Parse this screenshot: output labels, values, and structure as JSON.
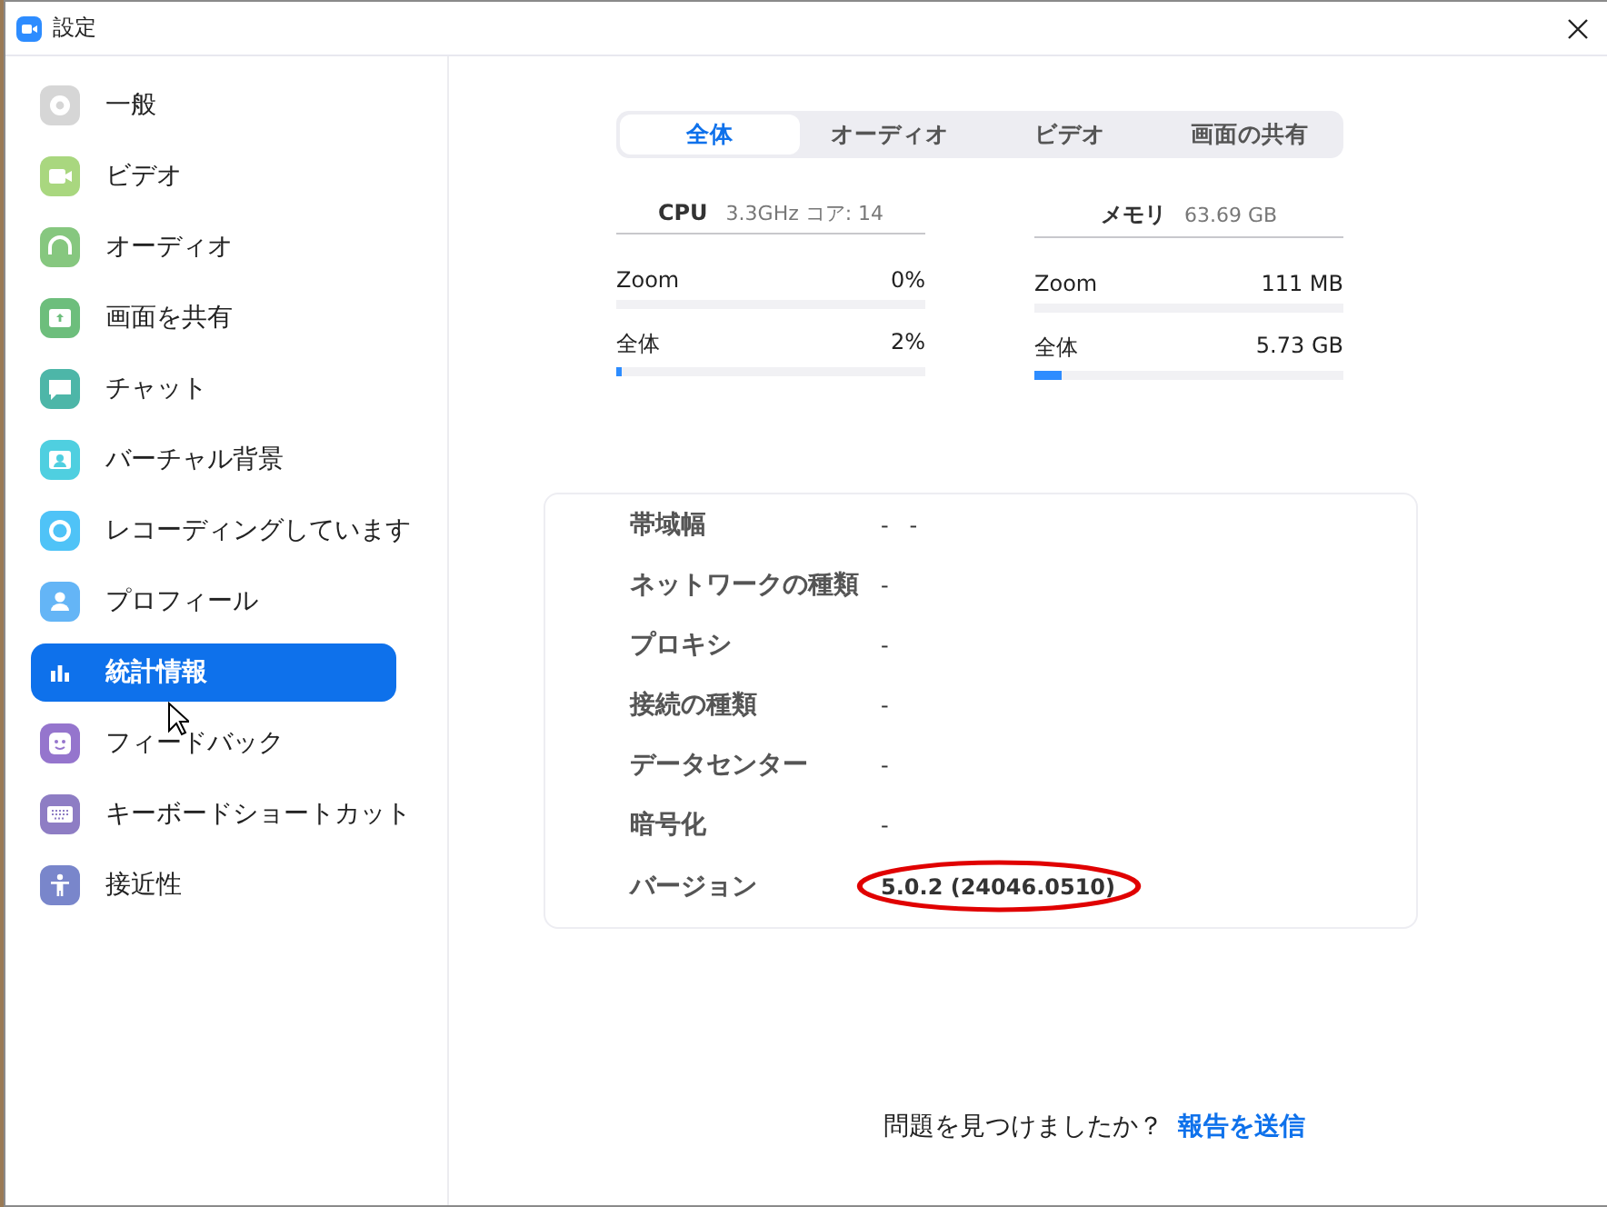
{
  "window": {
    "title": "設定"
  },
  "sidebar": {
    "items": [
      {
        "label": "一般",
        "kind": "gear",
        "color": "#d6d6d6",
        "selected": false
      },
      {
        "label": "ビデオ",
        "kind": "camera",
        "color": "#a9d77f",
        "selected": false
      },
      {
        "label": "オーディオ",
        "kind": "headphones",
        "color": "#86c77f",
        "selected": false
      },
      {
        "label": "画面を共有",
        "kind": "share",
        "color": "#6dbe7c",
        "selected": false
      },
      {
        "label": "チャット",
        "kind": "chat",
        "color": "#4db6a8",
        "selected": false
      },
      {
        "label": "バーチャル背景",
        "kind": "person-card",
        "color": "#4fcfe0",
        "selected": false
      },
      {
        "label": "レコーディングしています",
        "kind": "record",
        "color": "#4fc3f7",
        "selected": false
      },
      {
        "label": "プロフィール",
        "kind": "person",
        "color": "#64b5f6",
        "selected": false
      },
      {
        "label": "統計情報",
        "kind": "stats",
        "color": "#0e71eb",
        "selected": true
      },
      {
        "label": "フィードバック",
        "kind": "smile",
        "color": "#9575cd",
        "selected": false
      },
      {
        "label": "キーボードショートカット",
        "kind": "keyboard",
        "color": "#8e7dc4",
        "selected": false
      },
      {
        "label": "接近性",
        "kind": "access",
        "color": "#7986cb",
        "selected": false
      }
    ]
  },
  "tabs": [
    {
      "label": "全体",
      "selected": true
    },
    {
      "label": "オーディオ",
      "selected": false
    },
    {
      "label": "ビデオ",
      "selected": false
    },
    {
      "label": "画面の共有",
      "selected": false
    }
  ],
  "resources": [
    {
      "title": "CPU",
      "detail": "3.3GHz  コア: 14",
      "rows": [
        {
          "label": "Zoom",
          "reading": "0%",
          "level": 0
        },
        {
          "label": "全体",
          "reading": "2%",
          "level": 0.02
        }
      ]
    },
    {
      "title": "メモリ",
      "detail": "63.69 GB",
      "rows": [
        {
          "label": "Zoom",
          "reading": "111 MB",
          "level": 0
        },
        {
          "label": "全体",
          "reading": "5.73 GB",
          "level": 0.09
        }
      ]
    }
  ],
  "info": [
    {
      "label": "帯域幅",
      "value": "-   -",
      "circled": false
    },
    {
      "label": "ネットワークの種類",
      "value": "-",
      "circled": false
    },
    {
      "label": "プロキシ",
      "value": "-",
      "circled": false
    },
    {
      "label": "接続の種類",
      "value": "-",
      "circled": false
    },
    {
      "label": "データセンター",
      "value": "-",
      "circled": false
    },
    {
      "label": "暗号化",
      "value": "-",
      "circled": false
    },
    {
      "label": "バージョン",
      "value": "5.0.2 (24046.0510)",
      "circled": true
    }
  ],
  "footer": {
    "text": "問題を見つけましたか？",
    "link": "報告を送信"
  }
}
